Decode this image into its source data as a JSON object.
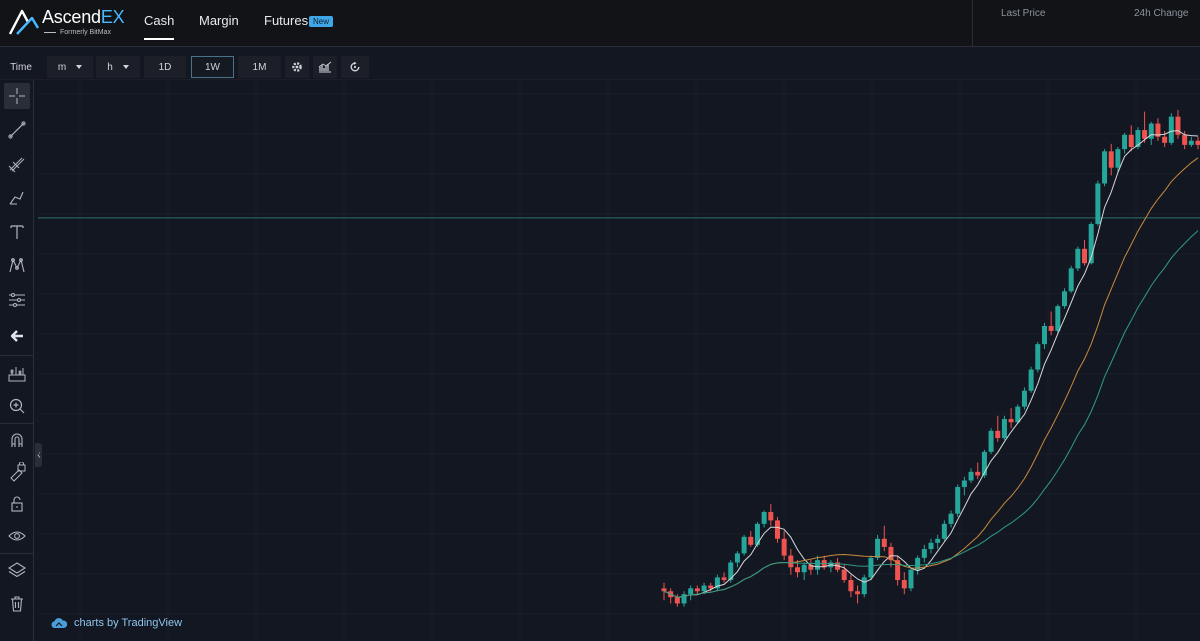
{
  "brand": {
    "name_main": "Ascend",
    "name_accent": "EX",
    "tagline": "Formerly BitMax",
    "accent_color": "#48b9ff"
  },
  "nav": {
    "cash": "Cash",
    "margin": "Margin",
    "futures": "Futures",
    "futures_badge": "New"
  },
  "market_header": {
    "last_price_label": "Last Price",
    "change_label": "24h Change"
  },
  "toolbar": {
    "time_label": "Time",
    "minutes": "m",
    "hours": "h",
    "day": "1D",
    "week": "1W",
    "month": "1M",
    "selected": "1W"
  },
  "left_tools": [
    {
      "name": "crosshair-icon"
    },
    {
      "name": "trend-line-icon"
    },
    {
      "name": "fib-retracement-icon"
    },
    {
      "name": "brush-icon"
    },
    {
      "name": "text-icon"
    },
    {
      "name": "pattern-icon"
    },
    {
      "name": "measure-icon"
    },
    {
      "name": "back-arrow-icon"
    },
    {
      "name": "ruler-icon"
    },
    {
      "name": "zoom-in-icon"
    },
    {
      "name": "magnet-icon"
    },
    {
      "name": "lock-drawings-icon"
    },
    {
      "name": "unlock-icon"
    },
    {
      "name": "eye-icon"
    },
    {
      "name": "layers-icon"
    },
    {
      "name": "trash-icon"
    }
  ],
  "watermark": "charts by TradingView",
  "colors": {
    "up": "#26a69a",
    "down": "#ef5350",
    "bg": "#131722"
  },
  "chart_data": {
    "type": "candlestick",
    "interval": "1W",
    "price_line_y": 0.243,
    "candles": [
      [
        0.47,
        0.49,
        0.43,
        0.46
      ],
      [
        0.46,
        0.47,
        0.42,
        0.44
      ],
      [
        0.44,
        0.45,
        0.41,
        0.42
      ],
      [
        0.42,
        0.46,
        0.41,
        0.45
      ],
      [
        0.45,
        0.48,
        0.43,
        0.47
      ],
      [
        0.47,
        0.48,
        0.45,
        0.46
      ],
      [
        0.46,
        0.49,
        0.45,
        0.48
      ],
      [
        0.48,
        0.49,
        0.46,
        0.47
      ],
      [
        0.47,
        0.52,
        0.46,
        0.51
      ],
      [
        0.51,
        0.53,
        0.49,
        0.5
      ],
      [
        0.5,
        0.58,
        0.49,
        0.57
      ],
      [
        0.57,
        0.62,
        0.55,
        0.61
      ],
      [
        0.61,
        0.7,
        0.6,
        0.69
      ],
      [
        0.69,
        0.72,
        0.64,
        0.65
      ],
      [
        0.65,
        0.77,
        0.64,
        0.76
      ],
      [
        0.76,
        0.84,
        0.74,
        0.83
      ],
      [
        0.83,
        0.88,
        0.75,
        0.78
      ],
      [
        0.78,
        0.8,
        0.66,
        0.68
      ],
      [
        0.68,
        0.72,
        0.58,
        0.6
      ],
      [
        0.6,
        0.63,
        0.52,
        0.55
      ],
      [
        0.55,
        0.58,
        0.51,
        0.53
      ],
      [
        0.53,
        0.57,
        0.5,
        0.56
      ],
      [
        0.56,
        0.58,
        0.52,
        0.54
      ],
      [
        0.54,
        0.6,
        0.52,
        0.58
      ],
      [
        0.58,
        0.6,
        0.54,
        0.55
      ],
      [
        0.55,
        0.58,
        0.53,
        0.57
      ],
      [
        0.57,
        0.59,
        0.53,
        0.54
      ],
      [
        0.54,
        0.56,
        0.49,
        0.5
      ],
      [
        0.5,
        0.52,
        0.44,
        0.46
      ],
      [
        0.46,
        0.48,
        0.42,
        0.45
      ],
      [
        0.45,
        0.52,
        0.44,
        0.51
      ],
      [
        0.51,
        0.6,
        0.5,
        0.59
      ],
      [
        0.59,
        0.7,
        0.58,
        0.68
      ],
      [
        0.68,
        0.75,
        0.62,
        0.64
      ],
      [
        0.64,
        0.66,
        0.55,
        0.58
      ],
      [
        0.58,
        0.6,
        0.48,
        0.5
      ],
      [
        0.5,
        0.53,
        0.45,
        0.47
      ],
      [
        0.47,
        0.55,
        0.46,
        0.54
      ],
      [
        0.54,
        0.6,
        0.52,
        0.59
      ],
      [
        0.59,
        0.65,
        0.57,
        0.63
      ],
      [
        0.63,
        0.68,
        0.61,
        0.66
      ],
      [
        0.66,
        0.7,
        0.63,
        0.68
      ],
      [
        0.68,
        0.78,
        0.67,
        0.76
      ],
      [
        0.76,
        0.84,
        0.74,
        0.82
      ],
      [
        0.82,
        1.02,
        0.8,
        1.0
      ],
      [
        1.0,
        1.08,
        0.94,
        1.05
      ],
      [
        1.05,
        1.15,
        1.03,
        1.12
      ],
      [
        1.12,
        1.2,
        1.06,
        1.09
      ],
      [
        1.09,
        1.32,
        1.07,
        1.3
      ],
      [
        1.3,
        1.55,
        1.28,
        1.52
      ],
      [
        1.52,
        1.7,
        1.4,
        1.44
      ],
      [
        1.44,
        1.7,
        1.42,
        1.66
      ],
      [
        1.66,
        1.8,
        1.55,
        1.62
      ],
      [
        1.62,
        1.85,
        1.6,
        1.82
      ],
      [
        1.82,
        2.1,
        1.78,
        2.05
      ],
      [
        2.05,
        2.45,
        2.02,
        2.4
      ],
      [
        2.4,
        2.95,
        2.35,
        2.9
      ],
      [
        2.9,
        3.4,
        2.8,
        3.32
      ],
      [
        3.32,
        3.7,
        3.1,
        3.2
      ],
      [
        3.2,
        3.9,
        3.15,
        3.85
      ],
      [
        3.85,
        4.4,
        3.78,
        4.3
      ],
      [
        4.3,
        5.2,
        4.25,
        5.1
      ],
      [
        5.1,
        6.0,
        5.0,
        5.9
      ],
      [
        5.9,
        6.3,
        5.2,
        5.3
      ],
      [
        5.3,
        7.2,
        5.25,
        7.1
      ],
      [
        7.1,
        9.8,
        7.0,
        9.6
      ],
      [
        9.6,
        12.4,
        9.4,
        12.2
      ],
      [
        12.2,
        12.9,
        10.2,
        10.8
      ],
      [
        10.8,
        12.6,
        10.5,
        12.4
      ],
      [
        12.4,
        14.0,
        12.0,
        13.8
      ],
      [
        13.8,
        14.8,
        12.2,
        12.6
      ],
      [
        12.6,
        14.6,
        12.4,
        14.3
      ],
      [
        14.3,
        16.4,
        13.0,
        13.4
      ],
      [
        13.4,
        15.2,
        12.8,
        15.0
      ],
      [
        15.0,
        15.6,
        13.2,
        13.6
      ],
      [
        13.6,
        14.2,
        12.6,
        13.0
      ],
      [
        13.0,
        16.2,
        12.8,
        15.8
      ],
      [
        15.8,
        16.6,
        13.4,
        13.8
      ],
      [
        13.8,
        14.2,
        12.4,
        12.8
      ],
      [
        12.8,
        13.6,
        12.6,
        13.2
      ],
      [
        13.2,
        13.6,
        12.4,
        12.8
      ]
    ]
  }
}
